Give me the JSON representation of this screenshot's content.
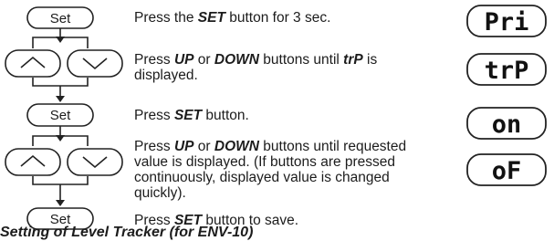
{
  "buttons": {
    "set_label": "Set",
    "up_icon": "up-arrow-icon",
    "down_icon": "down-arrow-icon"
  },
  "steps": [
    {
      "parts": [
        "Press the ",
        "SET",
        " button for 3 sec."
      ]
    },
    {
      "lines": [
        [
          "Press ",
          "UP",
          " or ",
          "DOWN",
          " buttons until ",
          "trP",
          " is"
        ],
        [
          "displayed."
        ]
      ]
    },
    {
      "parts": [
        "Press ",
        "SET",
        " button."
      ]
    },
    {
      "lines": [
        [
          "Press ",
          "UP",
          " or ",
          "DOWN",
          " buttons until requested"
        ],
        [
          "value is displayed. (If buttons are pressed"
        ],
        [
          "continuously, displayed value is changed"
        ],
        [
          "quickly)."
        ]
      ]
    },
    {
      "parts": [
        "Press ",
        "SET",
        " button to save."
      ]
    }
  ],
  "displays": [
    "Pri",
    "trP",
    "on",
    "oF"
  ],
  "footer": "Setting of Level Tracker (for ENV-10)"
}
